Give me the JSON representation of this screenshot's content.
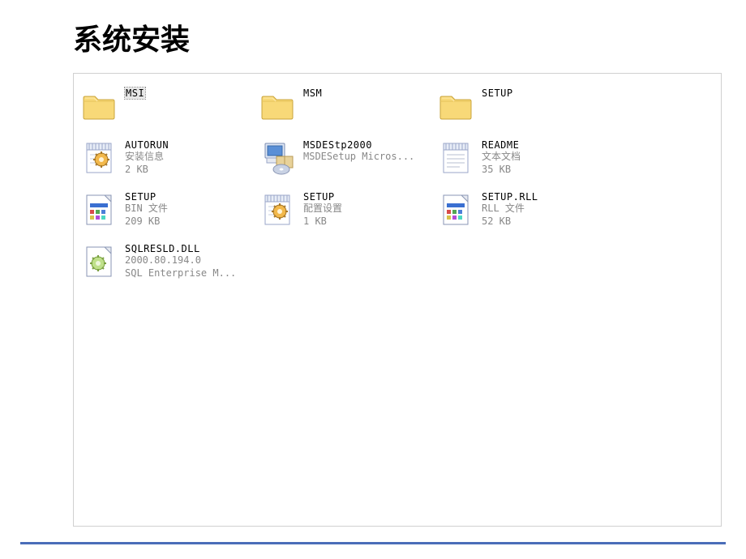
{
  "title": "系统安装",
  "items": [
    {
      "icon": "folder",
      "name": "MSI",
      "selected": true,
      "desc1": "",
      "desc2": ""
    },
    {
      "icon": "folder",
      "name": "MSM",
      "desc1": "",
      "desc2": ""
    },
    {
      "icon": "folder",
      "name": "SETUP",
      "desc1": "",
      "desc2": ""
    },
    {
      "icon": "config",
      "name": "AUTORUN",
      "desc1": "安装信息",
      "desc2": "2 KB"
    },
    {
      "icon": "installer",
      "name": "MSDEStp2000",
      "desc1": "MSDESetup Micros...",
      "desc2": ""
    },
    {
      "icon": "text",
      "name": "README",
      "desc1": "文本文档",
      "desc2": "35 KB"
    },
    {
      "icon": "bin",
      "name": "SETUP",
      "desc1": "BIN 文件",
      "desc2": "209 KB"
    },
    {
      "icon": "config",
      "name": "SETUP",
      "desc1": "配置设置",
      "desc2": "1 KB"
    },
    {
      "icon": "bin",
      "name": "SETUP.RLL",
      "desc1": "RLL 文件",
      "desc2": "52 KB"
    },
    {
      "icon": "dll",
      "name": "SQLRESLD.DLL",
      "desc1": "2000.80.194.0",
      "desc2": "SQL Enterprise M..."
    }
  ]
}
